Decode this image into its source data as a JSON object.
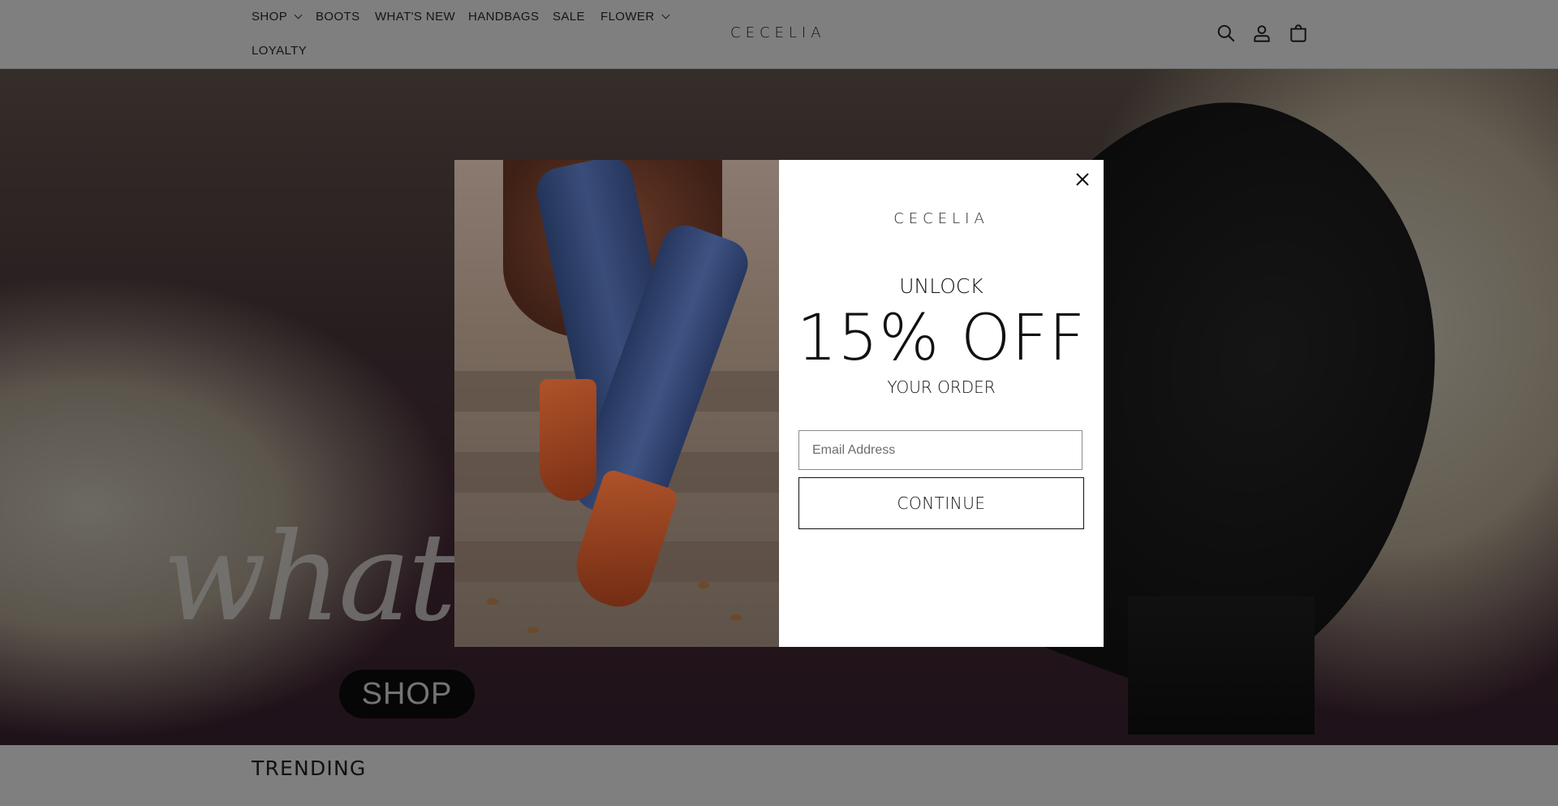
{
  "header": {
    "nav": [
      {
        "label": "SHOP",
        "has_dropdown": true
      },
      {
        "label": "BOOTS",
        "has_dropdown": false
      },
      {
        "label": "WHAT'S NEW",
        "has_dropdown": false
      },
      {
        "label": "HANDBAGS",
        "has_dropdown": false
      },
      {
        "label": "SALE",
        "has_dropdown": false
      },
      {
        "label": "FLOWER",
        "has_dropdown": true
      },
      {
        "label": "LOYALTY",
        "has_dropdown": false
      }
    ],
    "logo": "CECELIA",
    "icons": [
      "search-icon",
      "account-icon",
      "cart-icon"
    ]
  },
  "hero": {
    "script_text": "what's",
    "cta_label": "SHOP"
  },
  "section": {
    "title": "TRENDING"
  },
  "modal": {
    "logo": "CECELIA",
    "unlock": "UNLOCK",
    "discount": "15% OFF",
    "subtitle": "YOUR ORDER",
    "email_placeholder": "Email Address",
    "email_value": "",
    "continue_label": "CONTINUE",
    "close_icon": "close-icon"
  },
  "colors": {
    "overlay": "rgba(0,0,0,0.5)",
    "text": "#111111",
    "button_border": "#111111"
  }
}
